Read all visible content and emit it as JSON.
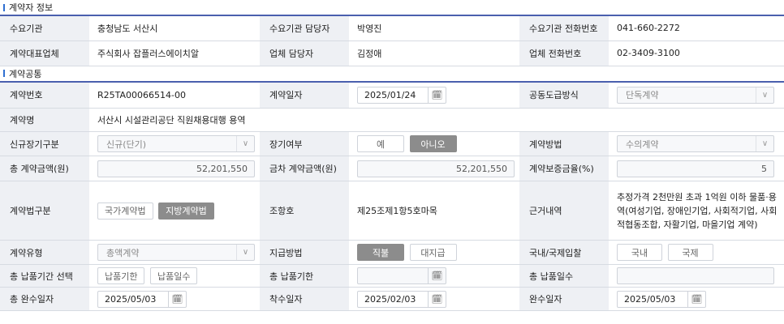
{
  "sections": {
    "contractor": "계약자 정보",
    "common": "계약공통"
  },
  "contractor": {
    "demand_org_label": "수요기관",
    "demand_org_value": "충청남도 서산시",
    "demand_manager_label": "수요기관 담당자",
    "demand_manager_value": "박영진",
    "demand_phone_label": "수요기관 전화번호",
    "demand_phone_value": "041-660-2272",
    "rep_company_label": "계약대표업체",
    "rep_company_value": "주식회사 잡플러스에이치알",
    "company_manager_label": "업체 담당자",
    "company_manager_value": "김정애",
    "company_phone_label": "업체 전화번호",
    "company_phone_value": "02-3409-3100"
  },
  "common": {
    "contract_no_label": "계약번호",
    "contract_no_value": "R25TA00066514-00",
    "contract_date_label": "계약일자",
    "contract_date_value": "2025/01/24",
    "joint_supply_label": "공동도급방식",
    "joint_supply_value": "단독계약",
    "contract_name_label": "계약명",
    "contract_name_value": "서산시 시설관리공단 직원채용대행 용역",
    "new_long_label": "신규장기구분",
    "new_long_value": "신규(단기)",
    "long_term_label": "장기여부",
    "long_term_yes": "예",
    "long_term_no": "아니오",
    "method_label": "계약방법",
    "method_value": "수의계약",
    "total_amount_label": "총 계약금액(원)",
    "total_amount_value": "52,201,550",
    "current_amount_label": "금차 계약금액(원)",
    "current_amount_value": "52,201,550",
    "guarantee_label": "계약보증금율(%)",
    "guarantee_value": "5",
    "law_type_label": "계약법구분",
    "law_national": "국가계약법",
    "law_local": "지방계약법",
    "clause_label": "조항호",
    "clause_value": "제25조제1항5호마목",
    "basis_label": "근거내역",
    "basis_value": "추정가격 2천만원 초과 1억원 이하 물품·용역(여성기업, 장애인기업, 사회적기업, 사회적협동조합, 자활기업, 마을기업 계약)",
    "type_label": "계약유형",
    "type_value": "총액계약",
    "payment_label": "지급방법",
    "payment_direct": "직불",
    "payment_proxy": "대지급",
    "bid_label": "국내/국제입찰",
    "bid_domestic": "국내",
    "bid_international": "국제",
    "delivery_select_label": "총 납품기간 선택",
    "delivery_deadline_btn": "납품기한",
    "delivery_days_btn": "납품일수",
    "delivery_deadline_label": "총 납품기한",
    "delivery_deadline_value": "",
    "delivery_days_label": "총 납품일수",
    "delivery_days_value": "",
    "total_completion_label": "총 완수일자",
    "total_completion_value": "2025/05/03",
    "start_label": "착수일자",
    "start_value": "2025/02/03",
    "completion_label": "완수일자",
    "completion_value": "2025/05/03"
  },
  "icons": {
    "calendar": "calendar-icon",
    "chevron": "chevron-down-icon"
  },
  "colors": {
    "section_accent": "#2f6fd1",
    "section_rule": "#4a5fae",
    "label_bg": "#eef0f4",
    "active_button": "#8c8c8c"
  }
}
